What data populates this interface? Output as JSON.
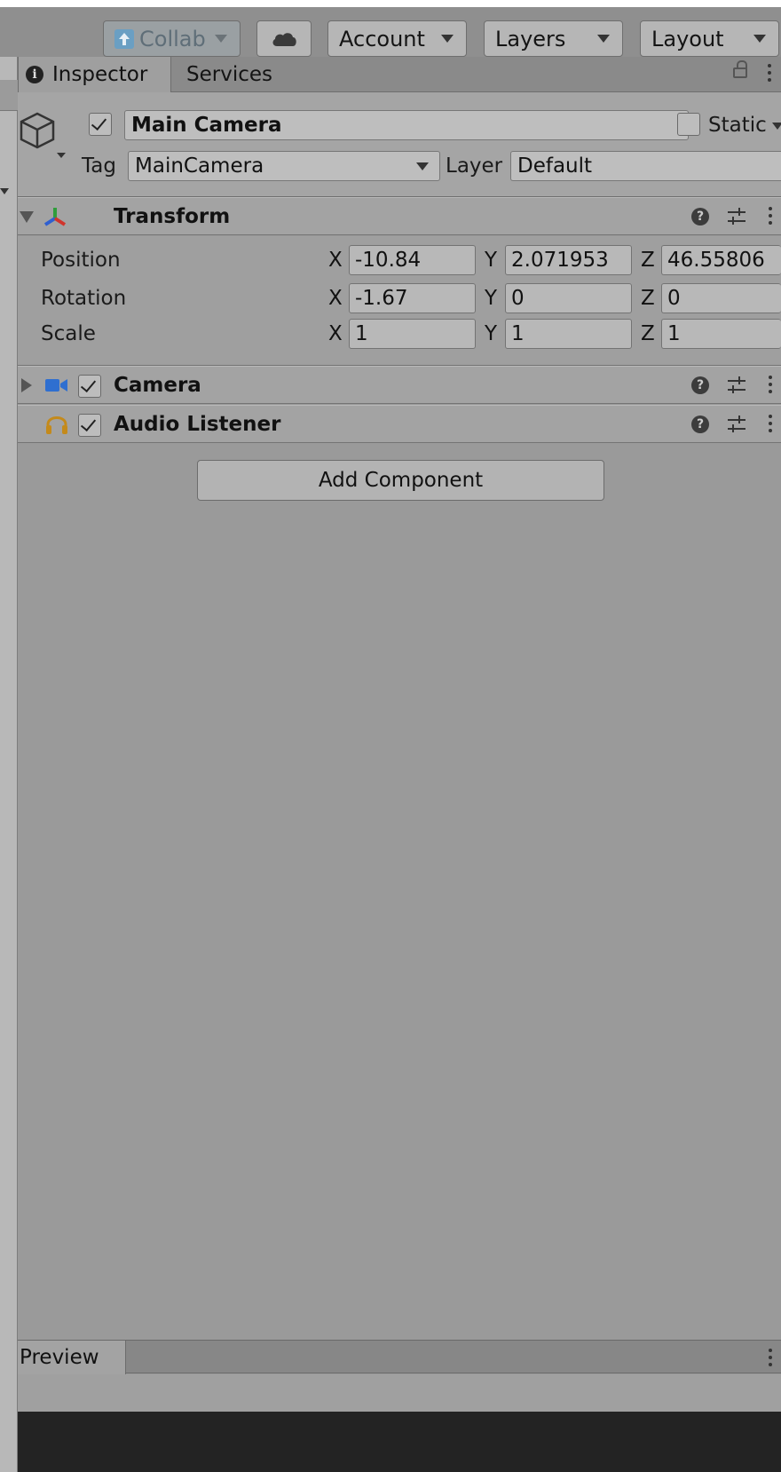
{
  "toolbar": {
    "collab_label": "Collab",
    "account_label": "Account",
    "layers_label": "Layers",
    "layout_label": "Layout",
    "icons": [
      "collab-upload-icon",
      "cloud-icon"
    ]
  },
  "tabs": {
    "inspector": "Inspector",
    "services": "Services"
  },
  "object": {
    "active": true,
    "name": "Main Camera",
    "static_label": "Static",
    "static": false,
    "tag_label": "Tag",
    "tag_value": "MainCamera",
    "layer_label": "Layer",
    "layer_value": "Default"
  },
  "transform": {
    "title": "Transform",
    "expanded": true,
    "position": {
      "label": "Position",
      "x": "-10.84",
      "y": "2.071953",
      "z": "46.55806"
    },
    "rotation": {
      "label": "Rotation",
      "x": "-1.67",
      "y": "0",
      "z": "0"
    },
    "scale": {
      "label": "Scale",
      "x": "1",
      "y": "1",
      "z": "1"
    }
  },
  "axes": {
    "x": "X",
    "y": "Y",
    "z": "Z"
  },
  "components": {
    "camera": {
      "title": "Camera",
      "enabled": true,
      "icon": "video-camera-icon"
    },
    "audio_listener": {
      "title": "Audio Listener",
      "enabled": true,
      "icon": "headphones-icon"
    }
  },
  "add_component_label": "Add Component",
  "preview_label": "Preview",
  "colors": {
    "camera_icon": "#2f6fd0",
    "headphones_icon": "#c48a1b",
    "transform_red": "#d0342c",
    "transform_green": "#2f9d3b",
    "transform_blue": "#2f5fd0"
  }
}
